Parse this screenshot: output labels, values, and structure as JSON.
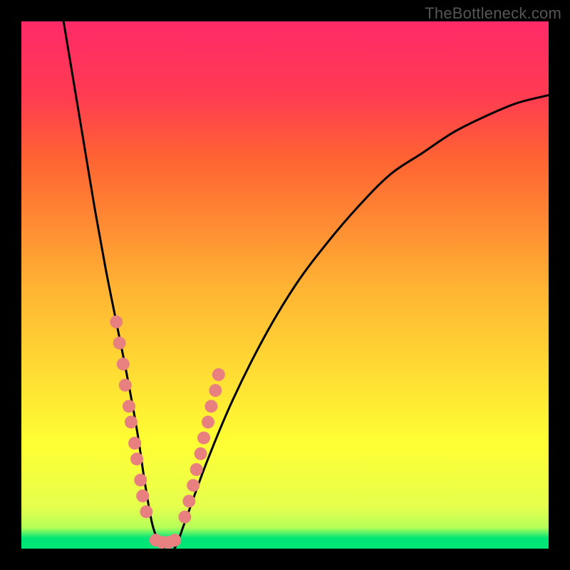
{
  "watermark": "TheBottleneck.com",
  "chart_data": {
    "type": "line",
    "title": "",
    "xlabel": "",
    "ylabel": "",
    "xlim": [
      0,
      100
    ],
    "ylim": [
      0,
      100
    ],
    "series": [
      {
        "name": "curve",
        "x": [
          8,
          10,
          12,
          14,
          16,
          18,
          20,
          22,
          23.5,
          25,
          27,
          29,
          31,
          35,
          40,
          46,
          52,
          58,
          64,
          70,
          76,
          82,
          88,
          94,
          100
        ],
        "y": [
          100,
          88,
          76,
          64,
          53,
          43,
          33,
          22,
          12,
          4,
          0,
          0,
          5,
          16,
          28,
          40,
          50,
          58,
          65,
          71,
          75,
          79,
          82,
          84.5,
          86
        ]
      },
      {
        "name": "dots-left",
        "x": [
          18.0,
          18.6,
          19.3,
          19.7,
          20.4,
          20.8,
          21.5,
          21.9,
          22.6,
          23.0,
          23.7
        ],
        "y": [
          43,
          39,
          35,
          31,
          27,
          24,
          20,
          17,
          13,
          10,
          7
        ]
      },
      {
        "name": "dots-bottom",
        "x": [
          25.5,
          26.7,
          27.9,
          29.1
        ],
        "y": [
          1.6,
          1.2,
          1.2,
          1.6
        ]
      },
      {
        "name": "dots-right",
        "x": [
          31.0,
          31.8,
          32.6,
          33.2,
          34.0,
          34.6,
          35.4,
          36.0,
          36.8,
          37.4
        ],
        "y": [
          6,
          9,
          12,
          15,
          18,
          21,
          24,
          27,
          30,
          33
        ]
      }
    ],
    "colors": {
      "curve": "#000000",
      "dots": "#e98080"
    }
  }
}
